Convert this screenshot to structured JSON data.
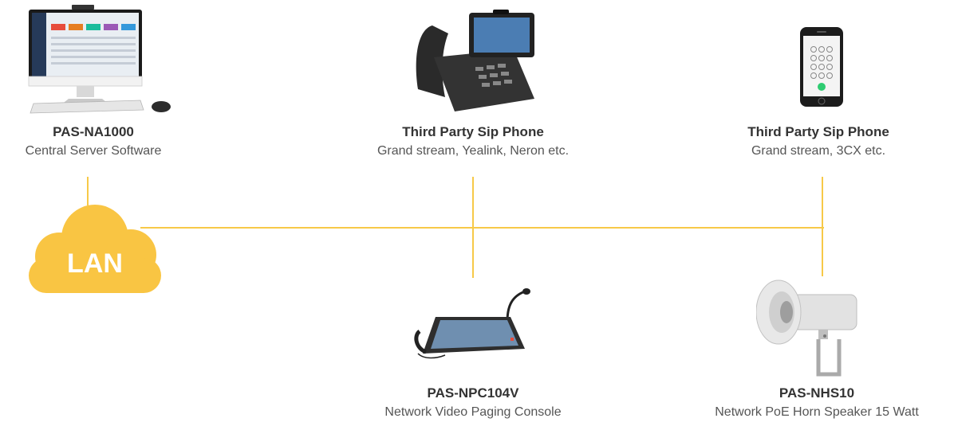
{
  "accent_color": "#f7c948",
  "network": {
    "label": "LAN",
    "icon": "cloud-icon"
  },
  "devices": [
    {
      "icon": "desktop-computer-icon",
      "name": "PAS-NA1000",
      "description": "Central Server Software"
    },
    {
      "icon": "desk-sip-phone-icon",
      "name": "Third Party Sip Phone",
      "description": "Grand stream, Yealink, Neron etc."
    },
    {
      "icon": "smartphone-icon",
      "name": "Third Party Sip Phone",
      "description": "Grand stream, 3CX etc."
    },
    {
      "icon": "paging-console-icon",
      "name": "PAS-NPC104V",
      "description": "Network Video Paging Console"
    },
    {
      "icon": "horn-speaker-icon",
      "name": "PAS-NHS10",
      "description": "Network PoE Horn Speaker 15 Watt"
    }
  ]
}
